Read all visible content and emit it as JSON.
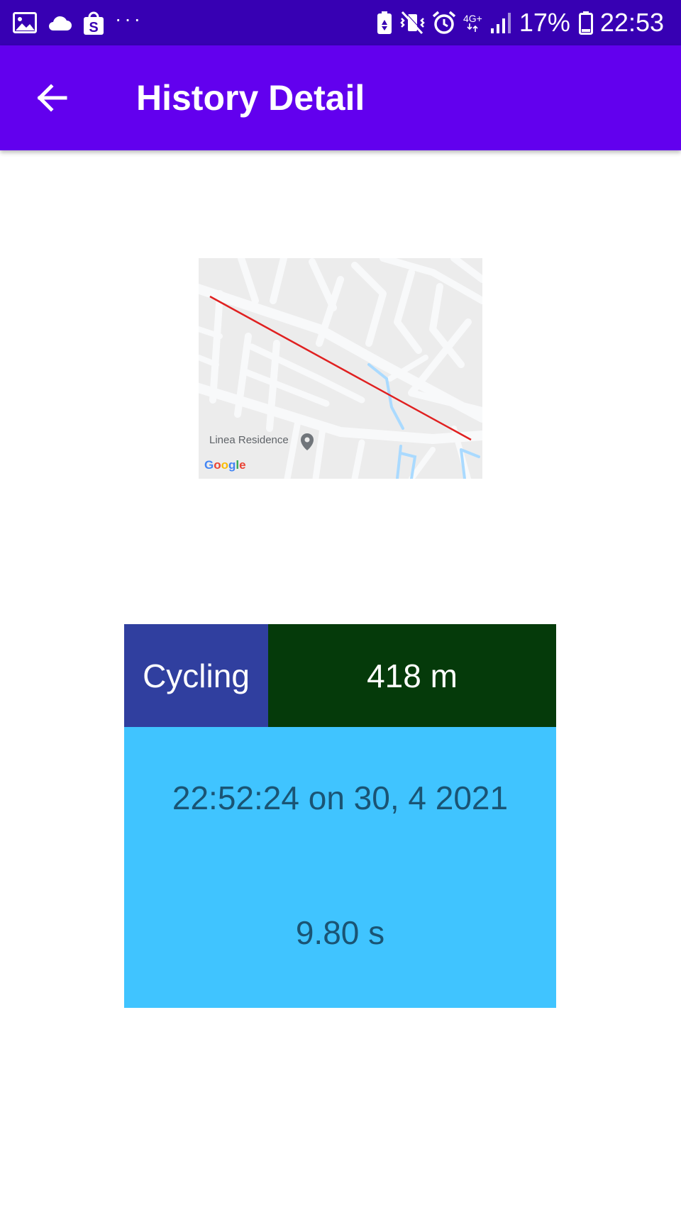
{
  "status_bar": {
    "left_icons": [
      "image-icon",
      "cloud-icon",
      "shopee-bag-icon"
    ],
    "more_indicator": "···",
    "network_type": "4G+",
    "battery_percent": "17%",
    "time": "22:53"
  },
  "app_bar": {
    "title": "History Detail",
    "back_icon": "arrow-back-icon"
  },
  "map": {
    "place_label": "Linea Residence",
    "attribution": "Google",
    "route_color": "#e02020"
  },
  "record": {
    "activity": "Cycling",
    "distance": "418 m",
    "datetime": "22:52:24 on 30, 4 2021",
    "duration": "9.80 s"
  },
  "colors": {
    "status_bar": "#3700b3",
    "app_bar": "#6200ee",
    "activity_bg": "#303f9f",
    "distance_bg": "#053a0a",
    "details_bg": "#40c4ff",
    "details_text": "#1a5474"
  }
}
